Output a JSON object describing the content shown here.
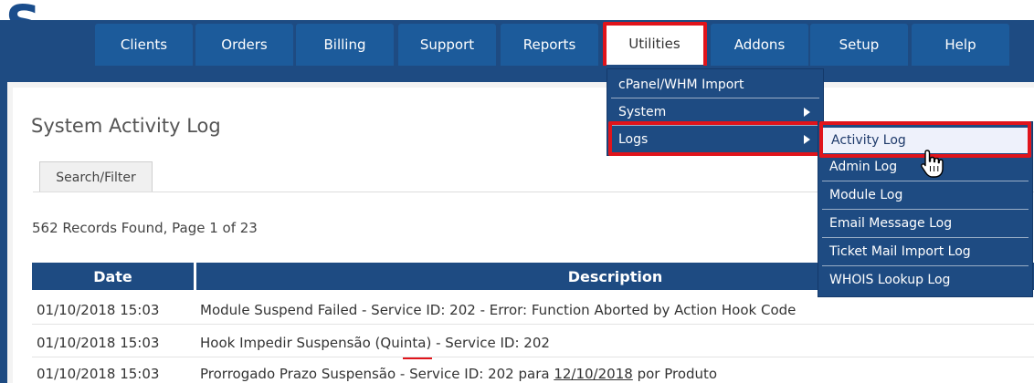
{
  "brand": {
    "logo_glyph": "S",
    "logo_color": "#1a4d8c"
  },
  "navbar": {
    "bg": "#1e4b82",
    "items": [
      {
        "label": "Clients"
      },
      {
        "label": "Orders"
      },
      {
        "label": "Billing"
      },
      {
        "label": "Support"
      },
      {
        "label": "Reports"
      },
      {
        "label": "Utilities",
        "active": true
      },
      {
        "label": "Addons"
      },
      {
        "label": "Setup"
      },
      {
        "label": "Help"
      }
    ]
  },
  "utilities_menu": {
    "items": [
      {
        "label": "cPanel/WHM Import",
        "has_submenu": false
      },
      {
        "label": "System",
        "has_submenu": true
      },
      {
        "label": "Logs",
        "has_submenu": true,
        "highlighted": true
      }
    ]
  },
  "logs_menu": {
    "items": [
      {
        "label": "Activity Log",
        "hovered": true
      },
      {
        "label": "Admin Log"
      },
      {
        "label": "Module Log"
      },
      {
        "label": "Email Message Log"
      },
      {
        "label": "Ticket Mail Import Log"
      },
      {
        "label": "WHOIS Lookup Log"
      }
    ]
  },
  "page": {
    "title": "System Activity Log",
    "tab_search": "Search/Filter",
    "records_found": "562 Records Found, Page 1 of 23"
  },
  "table": {
    "headers": [
      "Date",
      "Description"
    ],
    "rows": [
      {
        "date": "01/10/2018 15:03",
        "description": "Module Suspend Failed - Service ID: 202 - Error: Function Aborted by Action Hook Code"
      },
      {
        "date": "01/10/2018 15:03",
        "desc_pre": "Hook Impedir Suspensão (",
        "desc_mid": "Quinta",
        "desc_post": ") - Service ID: 202"
      },
      {
        "date": "01/10/2018 15:03",
        "desc_pre": "Prorrogado Prazo Suspensão - Service ID: 202 para ",
        "desc_link": "12/10/2018",
        "desc_post": " por Produto"
      }
    ]
  },
  "colors": {
    "accent_red": "#e0141b",
    "nav_blue": "#1e4b82",
    "tab_blue": "#1c5b9b"
  }
}
